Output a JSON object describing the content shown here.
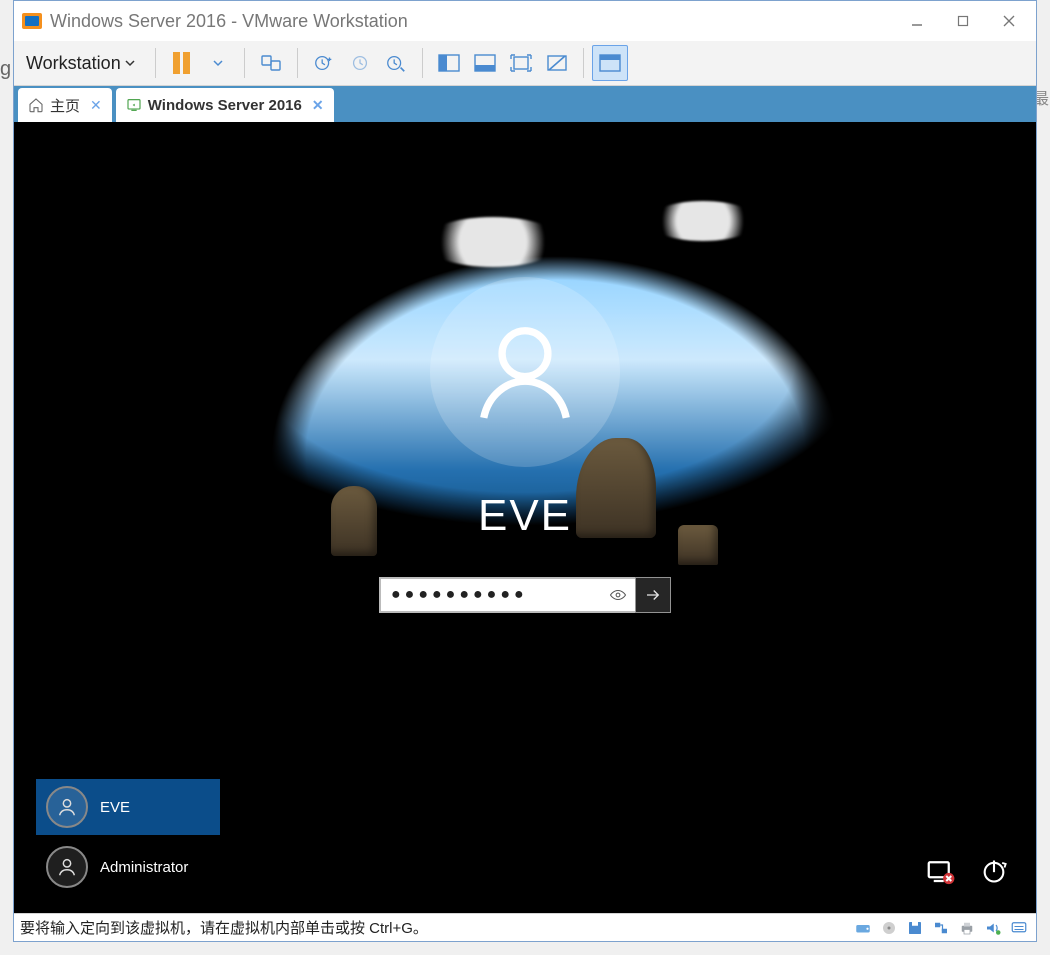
{
  "window": {
    "title": "Windows Server 2016 - VMware Workstation",
    "menu_label": "Workstation"
  },
  "tabs": {
    "home": "主页",
    "vm": "Windows Server 2016"
  },
  "login": {
    "user_display": "EVE",
    "password_mask": "●●●●●●●●●●",
    "accounts": [
      {
        "name": "EVE",
        "selected": true
      },
      {
        "name": "Administrator",
        "selected": false
      }
    ]
  },
  "statusbar": {
    "hint": "要将输入定向到该虚拟机，请在虚拟机内部单击或按 Ctrl+G。"
  },
  "background": {
    "right_hint": "最",
    "left_hint": "g"
  }
}
